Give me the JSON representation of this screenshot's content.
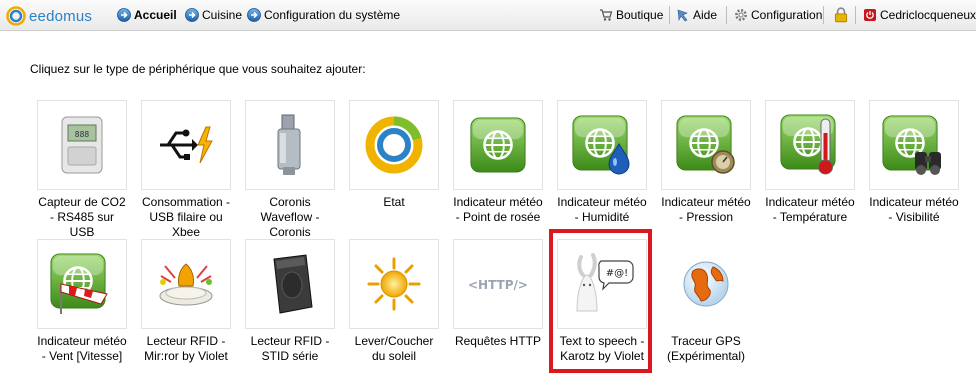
{
  "header": {
    "logo_text": "eedomus",
    "nav_left": [
      {
        "label": "Accueil",
        "icon": "circle-arrow-icon"
      },
      {
        "label": "Cuisine",
        "icon": "circle-arrow-icon"
      },
      {
        "label": "Configuration du système",
        "icon": "circle-arrow-icon"
      }
    ],
    "nav_right": [
      {
        "label": "Boutique",
        "icon": "cart-icon"
      },
      {
        "label": "Aide",
        "icon": "help-icon"
      },
      {
        "label": "Configuration",
        "icon": "gear-icon"
      },
      {
        "label": "",
        "icon": "lock-icon"
      },
      {
        "label": "Cedriclocqueneux",
        "icon": "logout-icon"
      }
    ]
  },
  "intro": "Cliquez sur le type de périphérique que vous souhaitez ajouter:",
  "devices": [
    {
      "label": "Capteur de CO2 - RS485 sur USB",
      "icon": "co2-sensor-icon"
    },
    {
      "label": "Consommation - USB filaire ou Xbee",
      "icon": "usb-power-icon"
    },
    {
      "label": "Coronis Waveflow - Coronis",
      "icon": "water-meter-icon"
    },
    {
      "label": "Etat",
      "icon": "state-ring-icon"
    },
    {
      "label": "Indicateur météo - Point de rosée",
      "icon": "weather-globe-icon"
    },
    {
      "label": "Indicateur météo - Humidité",
      "icon": "weather-humidity-icon"
    },
    {
      "label": "Indicateur météo - Pression",
      "icon": "weather-pressure-icon"
    },
    {
      "label": "Indicateur météo - Température",
      "icon": "weather-temperature-icon"
    },
    {
      "label": "Indicateur météo - Visibilité",
      "icon": "weather-visibility-icon"
    },
    {
      "label": "Indicateur météo - Vent [Vitesse]",
      "icon": "weather-wind-icon"
    },
    {
      "label": "Lecteur RFID - Mir:ror by Violet",
      "icon": "rfid-mirror-icon"
    },
    {
      "label": "Lecteur RFID - STID série",
      "icon": "rfid-stid-icon"
    },
    {
      "label": "Lever/Coucher du soleil",
      "icon": "sun-icon"
    },
    {
      "label": "Requêtes HTTP",
      "icon": "http-icon"
    },
    {
      "label": "Text to speech - Karotz by Violet",
      "icon": "karotz-rabbit-icon",
      "highlighted": true
    },
    {
      "label": "Traceur GPS (Expérimental)",
      "icon": "globe-gps-icon"
    }
  ],
  "colors": {
    "brand": "#2b82c6",
    "highlight": "#d9181f",
    "weather_green": "#5fa52b"
  }
}
